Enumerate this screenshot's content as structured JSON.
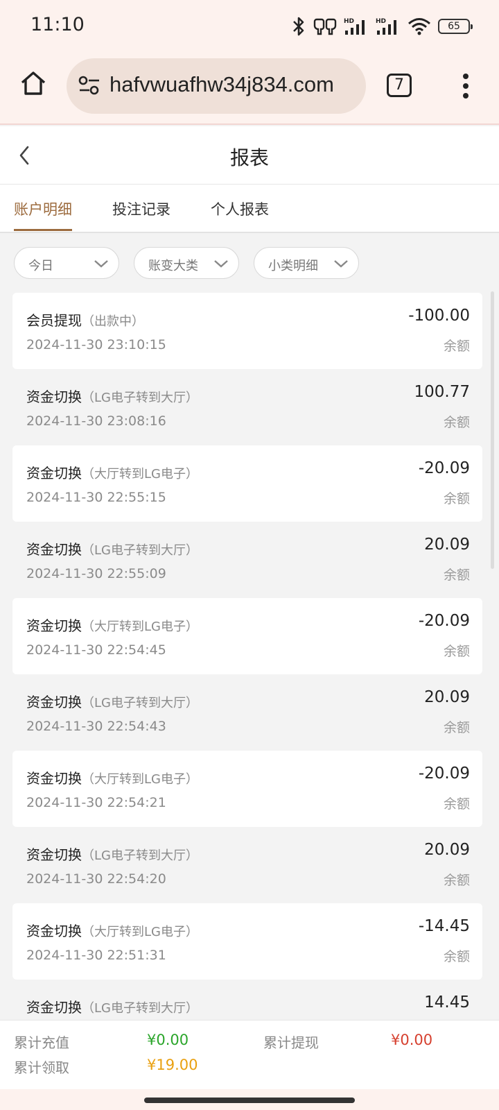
{
  "status_bar": {
    "time": "11:10",
    "battery": "65",
    "icons": [
      "bluetooth-icon",
      "earbuds-icon",
      "hd-signal-icon",
      "hd-signal-icon",
      "wifi-icon",
      "battery-icon"
    ]
  },
  "browser": {
    "url": "hafvwuafhw34j834.com",
    "tab_count": "7",
    "icons": {
      "home": "home-icon",
      "site_settings": "tune-icon",
      "menu": "more-vert-icon"
    }
  },
  "header": {
    "title": "报表",
    "back_icon": "chevron-left-icon"
  },
  "tabs": [
    {
      "label": "账户明细",
      "active": true
    },
    {
      "label": "投注记录",
      "active": false
    },
    {
      "label": "个人报表",
      "active": false
    }
  ],
  "filters": [
    {
      "label": "今日"
    },
    {
      "label": "账变大类"
    },
    {
      "label": "小类明细"
    }
  ],
  "records": [
    {
      "title": "会员提现",
      "sub": "（出款中）",
      "date": "2024-11-30 23:10:15",
      "amount": "-100.00",
      "balance": "余额"
    },
    {
      "title": "资金切换",
      "sub": "（LG电子转到大厅）",
      "date": "2024-11-30 23:08:16",
      "amount": "100.77",
      "balance": "余额"
    },
    {
      "title": "资金切换",
      "sub": "（大厅转到LG电子）",
      "date": "2024-11-30 22:55:15",
      "amount": "-20.09",
      "balance": "余额"
    },
    {
      "title": "资金切换",
      "sub": "（LG电子转到大厅）",
      "date": "2024-11-30 22:55:09",
      "amount": "20.09",
      "balance": "余额"
    },
    {
      "title": "资金切换",
      "sub": "（大厅转到LG电子）",
      "date": "2024-11-30 22:54:45",
      "amount": "-20.09",
      "balance": "余额"
    },
    {
      "title": "资金切换",
      "sub": "（LG电子转到大厅）",
      "date": "2024-11-30 22:54:43",
      "amount": "20.09",
      "balance": "余额"
    },
    {
      "title": "资金切换",
      "sub": "（大厅转到LG电子）",
      "date": "2024-11-30 22:54:21",
      "amount": "-20.09",
      "balance": "余额"
    },
    {
      "title": "资金切换",
      "sub": "（LG电子转到大厅）",
      "date": "2024-11-30 22:54:20",
      "amount": "20.09",
      "balance": "余额"
    },
    {
      "title": "资金切换",
      "sub": "（大厅转到LG电子）",
      "date": "2024-11-30 22:51:31",
      "amount": "-14.45",
      "balance": "余额"
    },
    {
      "title": "资金切换",
      "sub": "（LG电子转到大厅）",
      "date": "",
      "amount": "14.45",
      "balance": ""
    }
  ],
  "summary": {
    "recharge_label": "累计充值",
    "recharge_value": "¥0.00",
    "withdraw_label": "累计提现",
    "withdraw_value": "¥0.00",
    "claim_label": "累计领取",
    "claim_value": "¥19.00",
    "colors": {
      "recharge": "#2aa52a",
      "withdraw": "#d6402f",
      "claim": "#e9a010",
      "accent": "#9c6b3e"
    }
  }
}
